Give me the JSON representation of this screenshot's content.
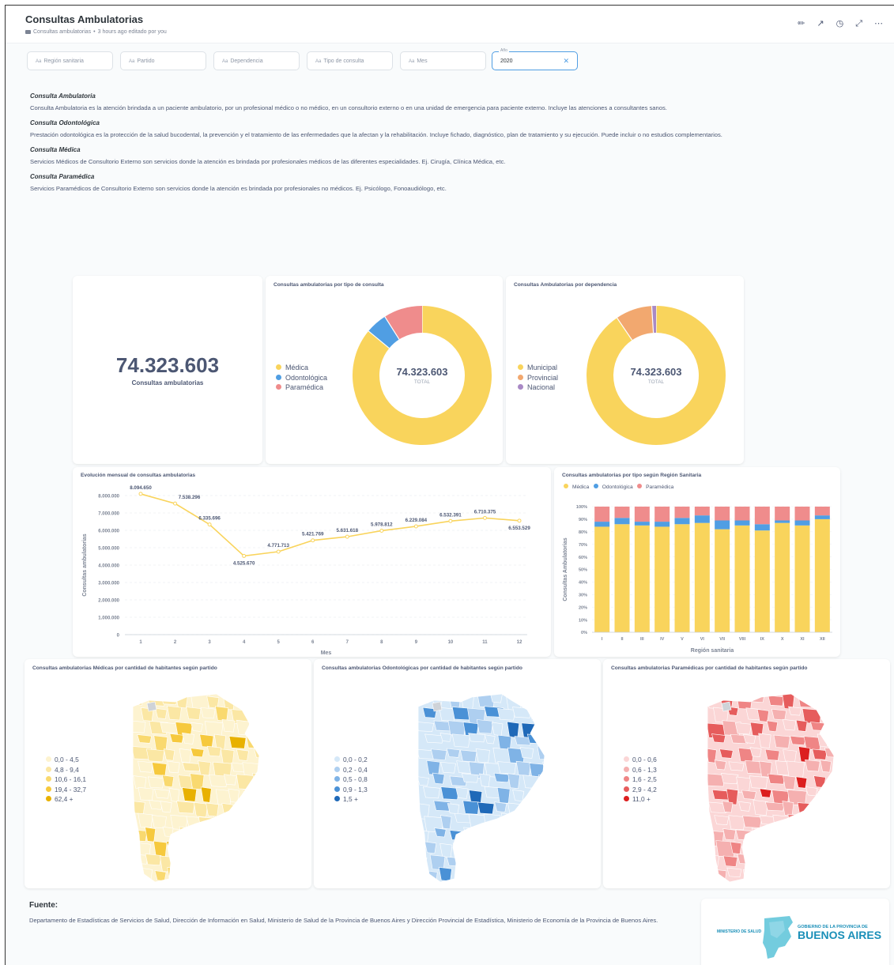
{
  "header": {
    "title": "Consultas Ambulatorias",
    "breadcrumb": "Consultas ambulatorias",
    "separator": "•",
    "edited": "3 hours ago editado por you"
  },
  "header_icons": [
    "pencil-icon",
    "arrow-icon",
    "clock-icon",
    "expand-icon",
    "more-icon"
  ],
  "filters": [
    {
      "label": "Región sanitaria"
    },
    {
      "label": "Partido"
    },
    {
      "label": "Dependencia"
    },
    {
      "label": "Tipo de consulta"
    },
    {
      "label": "Mes"
    }
  ],
  "filter_prefix": "Aa",
  "year_filter": {
    "label": "Año",
    "value": "2020"
  },
  "definitions": [
    {
      "title": "Consulta Ambulatoria",
      "text": "Consulta Ambulatoria es la atención brindada a un paciente ambulatorio, por un profesional médico o no médico, en un consultorio externo o en una unidad de emergencia para paciente externo. Incluye las atenciones a consultantes sanos."
    },
    {
      "title": "Consulta Odontológica",
      "text": "Prestación odontológica es la protección de la salud bucodental, la prevención y el tratamiento de las enfermedades que la afectan y la rehabilitación. Incluye fichado, diagnóstico, plan de tratamiento y su ejecución. Puede incluir o no estudios complementarios."
    },
    {
      "title": "Consulta Médica",
      "text": "Servicios Médicos de Consultorio Externo son servicios donde la atención es brindada por profesionales médicos de las diferentes especialidades. Ej. Cirugía, Clínica Médica, etc."
    },
    {
      "title": "Consulta Paramédica",
      "text": "Servicios Paramédicos de Consultorio Externo son servicios donde la atención es brindada por profesionales no médicos. Ej. Psicólogo, Fonoaudiólogo, etc."
    }
  ],
  "kpi": {
    "value": "74.323.603",
    "label": "Consultas ambulatorias"
  },
  "colors": {
    "yellow": "#f9d45c",
    "blue": "#509ee3",
    "pink": "#ef8c8c",
    "orange": "#f2a86f",
    "purple": "#a989c5"
  },
  "donut_tipo": {
    "title": "Consultas ambulatorias por tipo de consulta",
    "total": "74.323.603",
    "total_label": "TOTAL",
    "legend": [
      {
        "name": "Médica",
        "color": "#f9d45c",
        "share": 0.86
      },
      {
        "name": "Odontológica",
        "color": "#509ee3",
        "share": 0.05
      },
      {
        "name": "Paramédica",
        "color": "#ef8c8c",
        "share": 0.09
      }
    ]
  },
  "donut_dep": {
    "title": "Consultas Ambulatorias por dependencia",
    "total": "74.323.603",
    "total_label": "TOTAL",
    "legend": [
      {
        "name": "Municipal",
        "color": "#f9d45c",
        "share": 0.905
      },
      {
        "name": "Provincial",
        "color": "#f2a86f",
        "share": 0.085
      },
      {
        "name": "Nacional",
        "color": "#a989c5",
        "share": 0.01
      }
    ]
  },
  "chart_data": [
    {
      "type": "line",
      "title": "Evolución mensual de consultas ambulatorias",
      "xlabel": "Mes",
      "ylabel": "Consultas ambulatorias",
      "x": [
        1,
        2,
        3,
        4,
        5,
        6,
        7,
        8,
        9,
        10,
        11,
        12
      ],
      "values": [
        8094650,
        7538296,
        6335696,
        4525670,
        4771713,
        5421769,
        5631618,
        5978812,
        6229084,
        6532391,
        6710375,
        6553529
      ],
      "labels": [
        "8.094.650",
        "7.538.296",
        "6.335.696",
        "4.525.670",
        "4.771.713",
        "5.421.769",
        "5.631.618",
        "5.978.812",
        "6.229.084",
        "6.532.391",
        "6.710.375",
        "6.553.529"
      ],
      "ylim": [
        0,
        8000000
      ],
      "yticks": [
        "0",
        "1.000.000",
        "2.000.000",
        "3.000.000",
        "4.000.000",
        "5.000.000",
        "6.000.000",
        "7.000.000",
        "8.000.000"
      ],
      "color": "#f9d45c"
    },
    {
      "type": "bar",
      "stacked": "100%",
      "title": "Consultas ambulatorias por tipo según Región Sanitaria",
      "xlabel": "Región sanitaria",
      "ylabel": "Consultas Ambulatorias",
      "categories": [
        "I",
        "II",
        "III",
        "IV",
        "V",
        "VI",
        "VII",
        "VIII",
        "IX",
        "X",
        "XI",
        "XII"
      ],
      "yticks": [
        "0%",
        "10%",
        "20%",
        "30%",
        "40%",
        "50%",
        "60%",
        "70%",
        "80%",
        "90%",
        "100%"
      ],
      "series": [
        {
          "name": "Médica",
          "color": "#f9d45c",
          "values": [
            84,
            86,
            85,
            84,
            86,
            87,
            82,
            85,
            81,
            87,
            85,
            90
          ]
        },
        {
          "name": "Odontológica",
          "color": "#509ee3",
          "values": [
            4,
            5,
            3,
            4,
            5,
            6,
            7,
            4,
            5,
            2,
            4,
            3
          ]
        },
        {
          "name": "Paramédica",
          "color": "#ef8c8c",
          "values": [
            12,
            9,
            12,
            12,
            9,
            7,
            11,
            11,
            14,
            11,
            11,
            7
          ]
        }
      ]
    }
  ],
  "maps": [
    {
      "title": "Consultas ambulatorias Médicas por cantidad de habitantes según partido",
      "legend": [
        "0,0 - 4,5",
        "4,8 - 9,4",
        "10,6 - 16,1",
        "19,4 - 32,7",
        "62,4 +"
      ],
      "colors": [
        "#fdf3d0",
        "#fbe7a4",
        "#f9d96f",
        "#f6c93d",
        "#e8b100"
      ]
    },
    {
      "title": "Consultas ambulatorias Odontológicas por cantidad de habitantes según partido",
      "legend": [
        "0,0 - 0,2",
        "0,2 - 0,4",
        "0,5 - 0,8",
        "0,9 - 1,3",
        "1,5 +"
      ],
      "colors": [
        "#d5e8f8",
        "#aecff0",
        "#7fb3e6",
        "#4a91d6",
        "#1f69b8"
      ]
    },
    {
      "title": "Consultas ambulatorias Paramédicas por cantidad de habitantes según partido",
      "legend": [
        "0,0 - 0,6",
        "0,6 - 1,3",
        "1,6 - 2,5",
        "2,9 - 4,2",
        "11,0 +"
      ],
      "colors": [
        "#fbd6d6",
        "#f5b0b0",
        "#ef8585",
        "#e65c5c",
        "#dc1f1f"
      ]
    }
  ],
  "fuente": {
    "title": "Fuente:",
    "text": "Departamento de Estadísticas de Servicios de Salud, Dirección de Información en Salud, Ministerio de Salud de la Provincia de Buenos Aires y Dirección Provincial de Estadística, Ministerio de Economía de la Provincia de Buenos Aires."
  },
  "logo": {
    "left": "MINISTERIO DE SALUD",
    "top": "GOBIERNO DE LA PROVINCIA DE",
    "main": "BUENOS AIRES"
  }
}
